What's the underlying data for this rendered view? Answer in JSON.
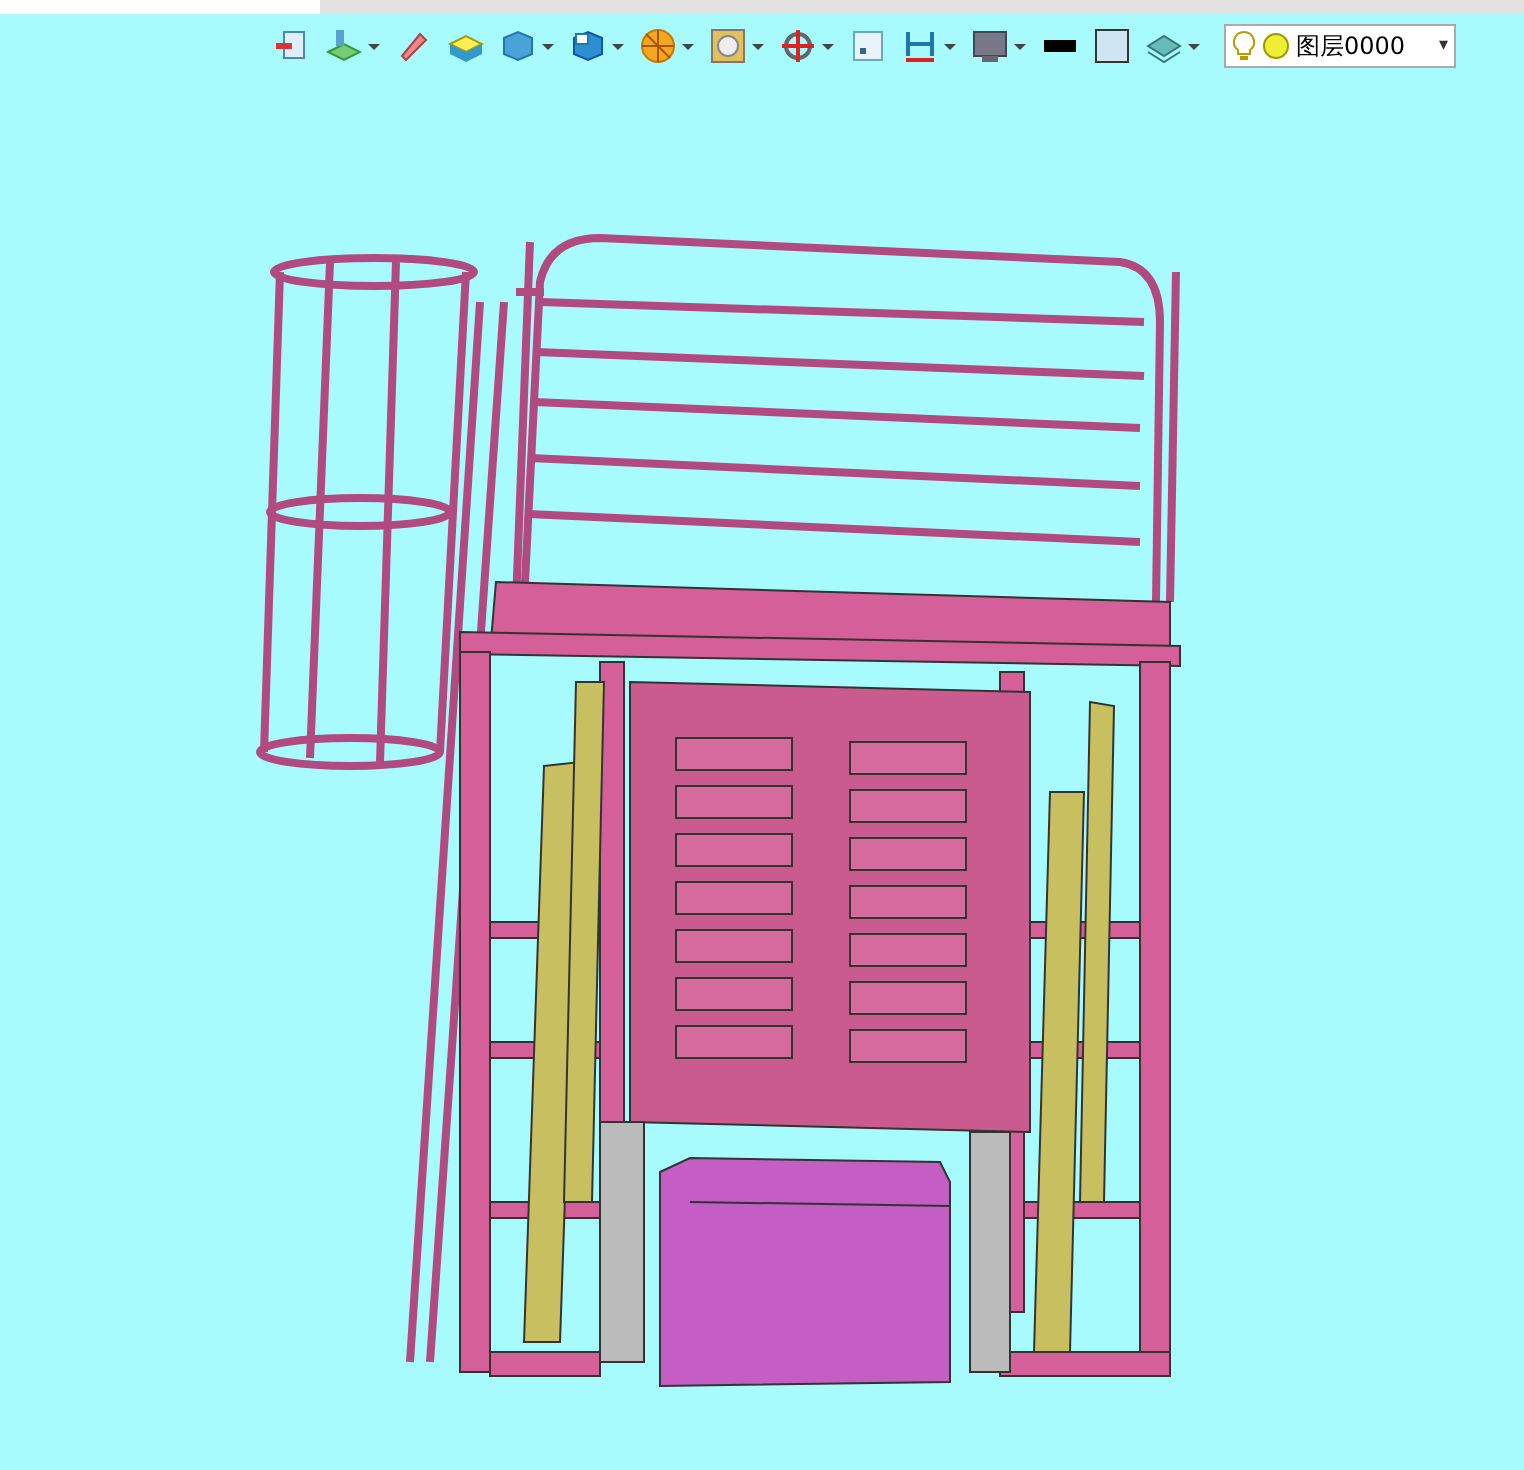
{
  "toolbar": [
    {
      "kind": "exit",
      "dropdown": false
    },
    {
      "kind": "surface",
      "dropdown": true
    },
    {
      "kind": "pencil",
      "dropdown": false
    },
    {
      "kind": "extrude",
      "dropdown": false
    },
    {
      "kind": "cube",
      "dropdown": true
    },
    {
      "kind": "view",
      "dropdown": true
    },
    {
      "kind": "wheel",
      "dropdown": true
    },
    {
      "kind": "sphere",
      "dropdown": true
    },
    {
      "kind": "target",
      "dropdown": true
    },
    {
      "kind": "frame",
      "dropdown": false
    },
    {
      "kind": "dimension",
      "dropdown": true
    },
    {
      "kind": "monitor",
      "dropdown": true
    },
    {
      "kind": "linestyle",
      "dropdown": false
    },
    {
      "kind": "fillcolor",
      "dropdown": false
    },
    {
      "kind": "layers",
      "dropdown": true
    }
  ],
  "layer_select": {
    "value": "图层0000",
    "caret": "▾"
  }
}
